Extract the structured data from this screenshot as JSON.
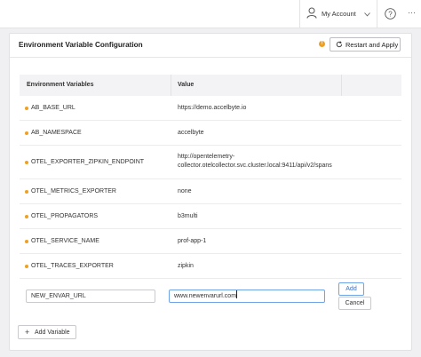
{
  "header": {
    "account_label": "My Account",
    "more_label": "···",
    "icons": {
      "user": "user-icon",
      "chevron": "chevron-down-icon",
      "help": "help-icon",
      "more": "more-icon"
    }
  },
  "card": {
    "title": "Environment Variable Configuration",
    "restart_label": "Restart and Apply",
    "warning_glyph": "!",
    "columns": {
      "name": "Environment Variables",
      "value": "Value"
    },
    "rows": [
      {
        "name": "AB_BASE_URL",
        "value": "https://demo.accelbyte.io"
      },
      {
        "name": "AB_NAMESPACE",
        "value": "accelbyte"
      },
      {
        "name": "OTEL_EXPORTER_ZIPKIN_ENDPOINT",
        "value": "http://opentelemetry-collector.otelcollector.svc.cluster.local:9411/api/v2/spans"
      },
      {
        "name": "OTEL_METRICS_EXPORTER",
        "value": "none"
      },
      {
        "name": "OTEL_PROPAGATORS",
        "value": "b3multi"
      },
      {
        "name": "OTEL_SERVICE_NAME",
        "value": "prof-app-1"
      },
      {
        "name": "OTEL_TRACES_EXPORTER",
        "value": "zipkin"
      }
    ],
    "new_entry": {
      "name_value": "NEW_ENVAR_URL",
      "value_value": "www.newenvarurl.com",
      "add_label": "Add",
      "cancel_label": "Cancel"
    },
    "add_variable_label": "Add Variable"
  },
  "colors": {
    "accent": "#3a6fc2",
    "warning": "#f0a020",
    "focus_border": "#6fa3e8"
  }
}
